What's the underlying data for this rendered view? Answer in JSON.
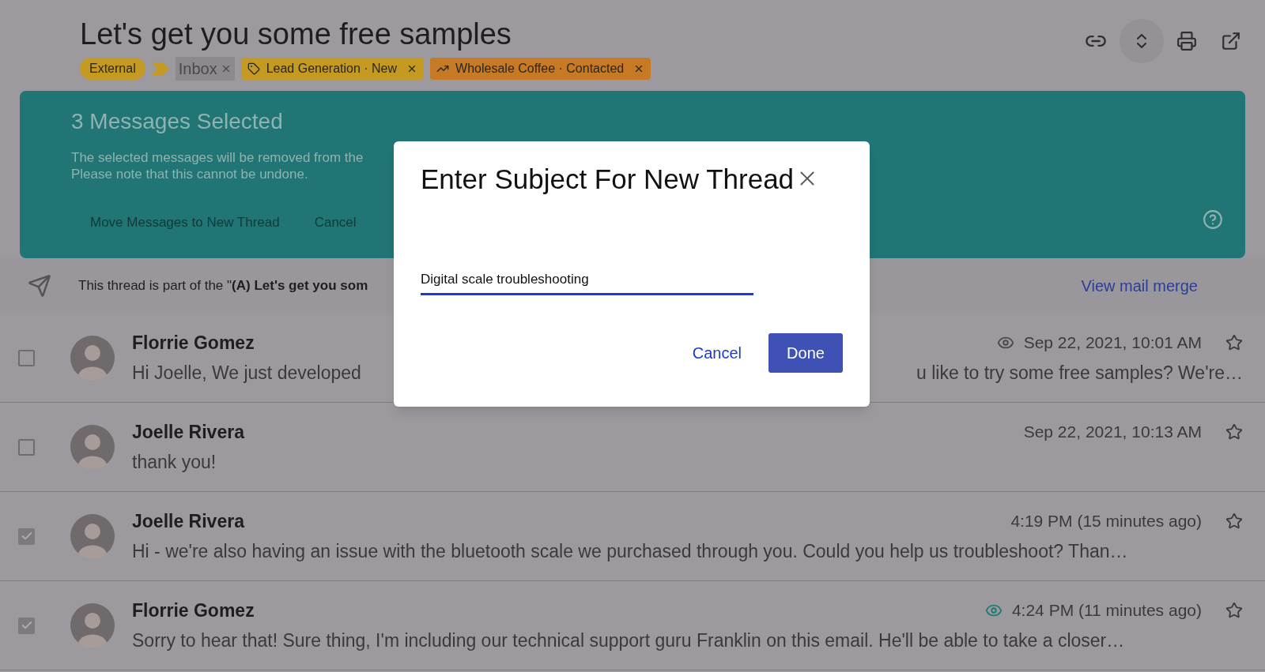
{
  "thread": {
    "title": "Let's get you some free samples",
    "labels": [
      {
        "kind": "pill",
        "text": "External",
        "color": "#c49a22"
      },
      {
        "kind": "marker",
        "color": "#c49a22"
      },
      {
        "kind": "system",
        "text": "Inbox",
        "color": "#8d8a8f"
      },
      {
        "kind": "tag",
        "text": "Lead Generation · New",
        "color": "#c49a22"
      },
      {
        "kind": "trend",
        "text": "Wholesale Coffee · Contacted",
        "color": "#c77a25"
      }
    ]
  },
  "banner": {
    "title": "3 Messages Selected",
    "description": [
      "The selected messages will be removed from the",
      "Please note that this cannot be undone."
    ],
    "actions": [
      "Move Messages to New Thread",
      "Cancel"
    ]
  },
  "mail_merge": {
    "text": "This thread is part of the \"**(A) Let's get you som**",
    "link": "View mail merge"
  },
  "messages": [
    {
      "sender": "Florrie Gomez",
      "preview": "Hi Joelle, We just developed",
      "preview_tail": "u like to try some free samples? We're…",
      "time": "Sep 22, 2021, 10:01 AM",
      "checked": false,
      "eye": {
        "color": "#4a484c"
      }
    },
    {
      "sender": "Joelle Rivera",
      "preview": "thank you!",
      "time": "Sep 22, 2021, 10:13 AM",
      "checked": false
    },
    {
      "sender": "Joelle Rivera",
      "preview": "Hi - we're also having an issue with the bluetooth scale we purchased through you. Could you help us troubleshoot? Than…",
      "time": "4:19 PM (15 minutes ago)",
      "checked": true
    },
    {
      "sender": "Florrie Gomez",
      "preview": "Sorry to hear that! Sure thing, I'm including our technical support guru Franklin on this email. He'll be able to take a closer…",
      "time": "4:24 PM (11 minutes ago)",
      "checked": true,
      "eye": {
        "color": "#1f7a78"
      }
    }
  ],
  "dialog": {
    "title": "Enter Subject For New Thread",
    "subject": "Digital scale troubleshooting",
    "buttons": [
      "Cancel",
      "Done"
    ]
  }
}
